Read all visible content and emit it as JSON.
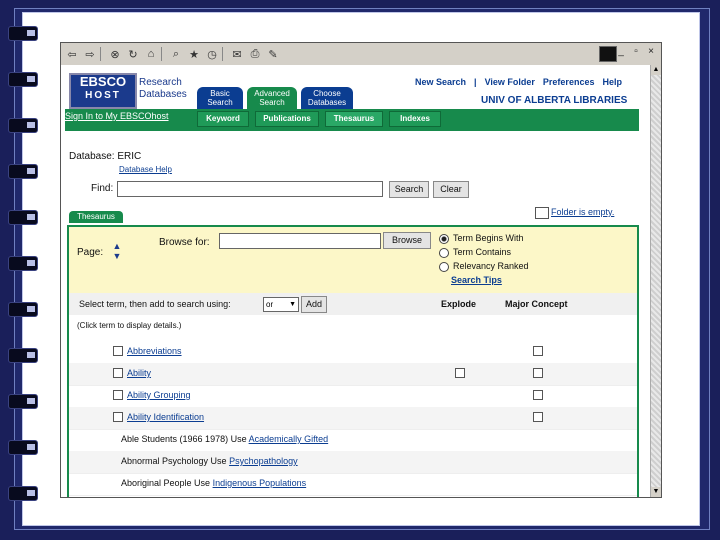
{
  "browser": {
    "toolbar_icons": [
      "back-arrow-icon",
      "forward-arrow-icon",
      "stop-icon",
      "refresh-icon",
      "home-icon",
      "search-icon",
      "favorites-icon",
      "history-icon",
      "mail-icon",
      "print-icon",
      "edit-icon"
    ],
    "window_controls": [
      "_",
      "▫",
      "×"
    ]
  },
  "header": {
    "logo_line1": "EBSCO",
    "logo_line2": "HOST",
    "product": "Research Databases",
    "tabs": [
      {
        "label": "Basic Search",
        "color": "#0b3d91"
      },
      {
        "label": "Advanced Search",
        "color": "#178a4c"
      },
      {
        "label": "Choose Databases",
        "color": "#0b3d91"
      }
    ],
    "links": [
      "New Search",
      "|",
      "View Folder",
      "Preferences",
      "Help"
    ],
    "institution": "UNIV OF ALBERTA LIBRARIES",
    "signin": "Sign In to My EBSCOhost",
    "subtabs": [
      "Keyword",
      "Publications",
      "Thesaurus",
      "Indexes"
    ]
  },
  "search": {
    "database_label": "Database: ERIC",
    "database_help": "Database Help",
    "find_label": "Find:",
    "find_value": "",
    "search_btn": "Search",
    "clear_btn": "Clear"
  },
  "thesaurus": {
    "tab_label": "Thesaurus",
    "folder_text": "Folder is empty.",
    "page_label": "Page:",
    "browse_label": "Browse for:",
    "browse_value": "",
    "browse_btn": "Browse",
    "radio_options": [
      "Term Begins With",
      "Term Contains",
      "Relevancy Ranked"
    ],
    "radio_selected": "Term Begins With",
    "tips": "Search Tips",
    "select_label": "Select term, then add to search using:",
    "or_value": "or",
    "add_btn": "Add",
    "col_explode": "Explode",
    "col_major": "Major Concept",
    "click_hint": "(Click term to display details.)"
  },
  "terms": [
    {
      "label": "Abbreviations",
      "explode": false,
      "major": true
    },
    {
      "label": "Ability",
      "explode": true,
      "major": true
    },
    {
      "label": "Ability Grouping",
      "explode": false,
      "major": true
    },
    {
      "label": "Ability Identification",
      "explode": false,
      "major": true
    }
  ],
  "use_rows": [
    {
      "text": "Able Students (1966 1978) Use",
      "link": "Academically Gifted"
    },
    {
      "text": "Abnormal Psychology Use",
      "link": "Psychopathology"
    },
    {
      "text": "Aboriginal People Use",
      "link": "Indigenous Populations"
    }
  ]
}
